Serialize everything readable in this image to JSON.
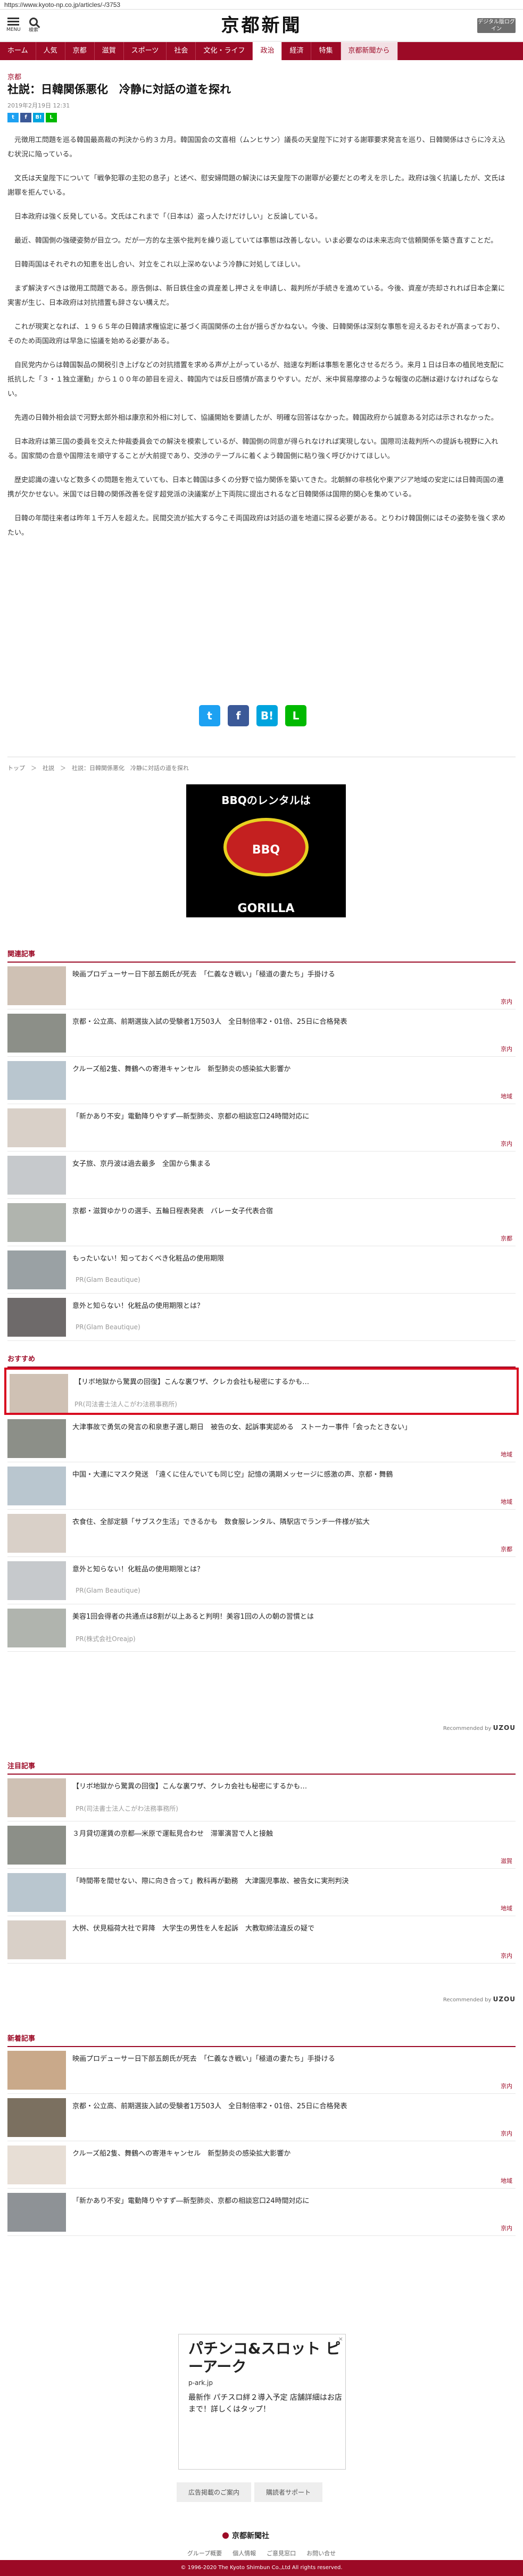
{
  "browser": {
    "url": "https://www.kyoto-np.co.jp/articles/-/3753"
  },
  "header": {
    "menu_label": "MENU",
    "search_label": "検索",
    "logo": "京都新聞",
    "digital_button": "デジタル版ログイン"
  },
  "gnav": [
    "ホーム",
    "人気",
    "京都",
    "滋賀",
    "スポーツ",
    "社会",
    "文化・ライフ",
    "政治",
    "経済",
    "特集",
    "京都新聞から"
  ],
  "article": {
    "category": "京都",
    "title": "社説：日韓関係悪化　冷静に対話の道を探れ",
    "date": "2019年2月19日 12:31",
    "paragraphs": [
      "元徴用工問題を巡る韓国最高裁の判決から約３カ月。韓国国会の文喜相（ムンヒサン）議長の天皇陛下に対する謝罪要求発言を巡り、日韓関係はさらに冷え込む状況に陥っている。",
      "文氏は天皇陛下について「戦争犯罪の主犯の息子」と述べ、慰安婦問題の解決には天皇陛下の謝罪が必要だとの考えを示した。政府は強く抗議したが、文氏は謝罪を拒んでいる。",
      "日本政府は強く反発している。文氏はこれまで「（日本は）盗っ人たけだけしい」と反論している。",
      "最近、韓国側の強硬姿勢が目立つ。だが一方的な主張や批判を繰り返していては事態は改善しない。いま必要なのは未来志向で信頼関係を築き直すことだ。",
      "日韓両国はそれぞれの知恵を出し合い、対立をこれ以上深めないよう冷静に対処してほしい。",
      "まず解決すべきは徴用工問題である。原告側は、新日鉄住金の資産差し押さえを申請し、裁判所が手続きを進めている。今後、資産が売却されれば日本企業に実害が生じ、日本政府は対抗措置も辞さない構えだ。",
      "これが現実となれば、１９６５年の日韓請求権協定に基づく両国関係の土台が揺らぎかねない。今後、日韓関係は深刻な事態を迎えるおそれが高まっており、そのため両国政府は早急に協議を始める必要がある。",
      "自民党内からは韓国製品の関税引き上げなどの対抗措置を求める声が上がっているが、拙速な判断は事態を悪化させるだろう。来月１日は日本の植民地支配に抵抗した「３・１独立運動」から１００年の節目を迎え、韓国内では反日感情が高まりやすい。だが、米中貿易摩擦のような報復の応酬は避けなければならない。",
      "先週の日韓外相会談で河野太郎外相は康京和外相に対して、協議開始を要請したが、明確な回答はなかった。韓国政府から誠意ある対応は示されなかった。",
      "日本政府は第三国の委員を交えた仲裁委員会での解決を模索しているが、韓国側の同意が得られなければ実現しない。国際司法裁判所への提訴も視野に入れる。国家間の合意や国際法を順守することが大前提であり、交渉のテーブルに着くよう韓国側に粘り強く呼びかけてほしい。",
      "歴史認識の違いなど数多くの問題を抱えていても、日本と韓国は多くの分野で協力関係を築いてきた。北朝鮮の非核化や東アジア地域の安定には日韓両国の連携が欠かせない。米国では日韓の関係改善を促す超党派の決議案が上下両院に提出されるなど日韓関係は国際的関心を集めている。",
      "日韓の年間往来者は昨年１千万人を超えた。民間交流が拡大する今こそ両国政府は対話の道を地道に探る必要がある。とりわけ韓国側にはその姿勢を強く求めたい。"
    ],
    "share_mini": [
      "t",
      "f",
      "B!",
      "L"
    ],
    "share_big": [
      "t",
      "f",
      "B!",
      "L"
    ],
    "breadcrumb": "トップ　＞　社説　＞　社説：日韓関係悪化　冷静に対話の道を探れ"
  },
  "ad1": {
    "title": "BBQのレンタルは",
    "logo": "BBQ GORILLA"
  },
  "related": {
    "heading": "関連記事",
    "items": [
      {
        "title": "映画プロデューサー日下部五朗氏が死去　「仁義なき戦い」「極道の妻たち」手掛ける",
        "tag": "京内",
        "pr": ""
      },
      {
        "title": "京都・公立高、前期選抜入試の受験者1万503人　全日制倍率2・01倍、25日に合格発表",
        "tag": "京内",
        "pr": ""
      },
      {
        "title": "クルーズ船2隻、舞鶴への寄港キャンセル　新型肺炎の感染拡大影響か",
        "tag": "地域",
        "pr": ""
      },
      {
        "title": "「新かあり不安」電動降りやすず―新型肺炎、京都の相談窓口24時間対応に",
        "tag": "京内",
        "pr": ""
      },
      {
        "title": "女子旅、京丹波は過去最多　全国から集まる",
        "tag": "",
        "pr": ""
      },
      {
        "title": "京都・滋賀ゆかりの選手、五輪日程表発表　バレー女子代表合宿",
        "tag": "京都",
        "pr": ""
      },
      {
        "title": "もったいない！知っておくべき化粧品の使用期限",
        "tag": "",
        "pr": "PR(Glam Beautique)"
      },
      {
        "title": "意外と知らない！化粧品の使用期限とは？",
        "tag": "",
        "pr": "PR(Glam Beautique)"
      }
    ]
  },
  "osusume": {
    "heading": "おすすめ",
    "items": [
      {
        "title": "【リボ地獄から驚異の回復】こんな裏ワザ、クレカ会社も秘密にするかも…",
        "tag": "",
        "pr": "PR(司法書士法人こがわ法務事務所)"
      },
      {
        "title": "大津事故で勇気の発言の和泉恵子選し期日　被告の女、起訴事実認める　ストーカー事件「会ったときない」",
        "tag": "地域",
        "pr": ""
      },
      {
        "title": "中国・大連にマスク発送　「遠くに住んでいても同じ空」記憶の満期メッセージに感激の声、京都・舞鶴",
        "tag": "地域",
        "pr": ""
      },
      {
        "title": "衣食住、全部定額「サブスク生活」できるかも　数食服レンタル、隣駅店でランチ一件様が拡大",
        "tag": "京都",
        "pr": ""
      },
      {
        "title": "意外と知らない！化粧品の使用期限とは？",
        "tag": "",
        "pr": "PR(Glam Beautique)"
      },
      {
        "title": "美容1回会得者の共通点は8割が以上あると判明！美容1回の人の朝の習慣とは",
        "tag": "",
        "pr": "PR(株式会社Oreajp)"
      }
    ],
    "powered": "Recommended by",
    "powered_brand": "UZOU"
  },
  "chumoku": {
    "heading": "注目記事",
    "items": [
      {
        "title": "【リボ地獄から驚異の回復】こんな裏ワザ、クレカ会社も秘密にするかも…",
        "tag": "",
        "pr": "PR(司法書士法人こがわ法務事務所)"
      },
      {
        "title": "３月貸切運賃の京都―米原で運転見合わせ　滞軍演習で人と接触",
        "tag": "滋賀",
        "pr": ""
      },
      {
        "title": "「時間帯を間せない、際に向き合って」教科再が勤務　大津園児事故、被告女に実刑判決",
        "tag": "地域",
        "pr": ""
      },
      {
        "title": "大桝、伏見稲荷大社で昇降　大学生の男性を人を起訴　大教取締法違反の疑で",
        "tag": "京内",
        "pr": ""
      }
    ],
    "powered": "Recommended by",
    "powered_brand": "UZOU"
  },
  "shinchaku": {
    "heading": "新着記事",
    "items": [
      {
        "title": "映画プロデューサー日下部五朗氏が死去　「仁義なき戦い」「極道の妻たち」手掛ける",
        "tag": "京内"
      },
      {
        "title": "京都・公立高、前期選抜入試の受験者1万503人　全日制倍率2・01倍、25日に合格発表",
        "tag": "京内"
      },
      {
        "title": "クルーズ船2隻、舞鶴への寄港キャンセル　新型肺炎の感染拡大影響か",
        "tag": "地域"
      },
      {
        "title": "「新かあり不安」電動降りやすず―新型肺炎、京都の相談窓口24時間対応に",
        "tag": "京内"
      }
    ]
  },
  "ad2": {
    "headline": "パチンコ&スロット ピーアーク",
    "source": "p-ark.jp",
    "body": "最新作 パチスロ絆２導入予定 店舗詳細はお店まで！詳しくはタップ！",
    "close": "×"
  },
  "footer": {
    "links": [
      "広告掲載のご案内",
      "購読者サポート"
    ],
    "logo": "京都新聞社",
    "nav": [
      "グループ概要",
      "個人情報",
      "ご意見窓口",
      "お問い合せ"
    ],
    "copyright": "© 1996-2020 The Kyoto Shimbun Co.,Ltd All rights reserved."
  },
  "colors": {
    "brand": "#9c0a26",
    "highlight": "#d80c20",
    "twitter": "#1da1f2",
    "facebook": "#3b5998",
    "hatena": "#00a4de",
    "line": "#00b900"
  }
}
